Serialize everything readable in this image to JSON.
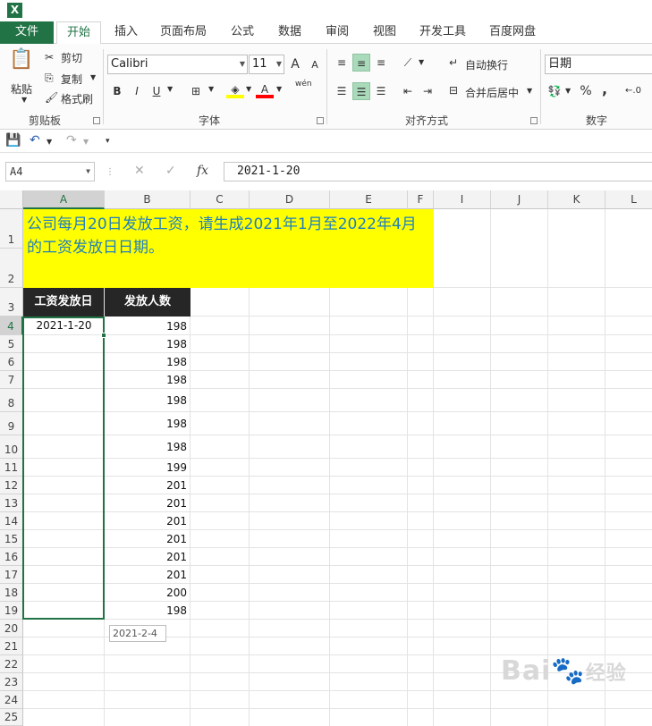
{
  "app": {
    "logo_letter": "X"
  },
  "ribbon_tabs": [
    "文件",
    "开始",
    "插入",
    "页面布局",
    "公式",
    "数据",
    "审阅",
    "视图",
    "开发工具",
    "百度网盘"
  ],
  "clipboard": {
    "paste": "粘贴",
    "cut": "剪切",
    "copy": "复制",
    "format_painter": "格式刷",
    "label": "剪贴板"
  },
  "font": {
    "name": "Calibri",
    "size": "11",
    "grow": "A",
    "shrink": "A",
    "bold": "B",
    "italic": "I",
    "underline": "U",
    "phonetic": "wén",
    "label": "字体"
  },
  "alignment": {
    "wrap_text": "自动换行",
    "merge_center": "合并后居中",
    "label": "对齐方式"
  },
  "number": {
    "format": "日期",
    "percent": "%",
    "comma": ",",
    "label": "数字"
  },
  "formula_bar": {
    "name_box": "A4",
    "fx": "fx",
    "content": "2021-1-20"
  },
  "columns": [
    "A",
    "B",
    "C",
    "D",
    "E",
    "F",
    "I",
    "J",
    "K",
    "L"
  ],
  "rows": [
    "1",
    "2",
    "3",
    "4",
    "5",
    "6",
    "7",
    "8",
    "9",
    "10",
    "11",
    "12",
    "13",
    "14",
    "15",
    "16",
    "17",
    "18",
    "19",
    "20",
    "21",
    "22",
    "23",
    "24",
    "25"
  ],
  "sheet": {
    "title_text": "公司每月20日发放工资，请生成2021年1月至2022年4月的工资发放日日期。",
    "header_a": "工资发放日",
    "header_b": "发放人数",
    "a4": "2021-1-20",
    "b_values": [
      "198",
      "198",
      "198",
      "198",
      "198",
      "198",
      "198",
      "199",
      "201",
      "201",
      "201",
      "201",
      "201",
      "201",
      "200",
      "198"
    ],
    "fill_tooltip": "2021-2-4"
  },
  "watermark": {
    "brand": "Bai",
    "suffix": "经验"
  }
}
